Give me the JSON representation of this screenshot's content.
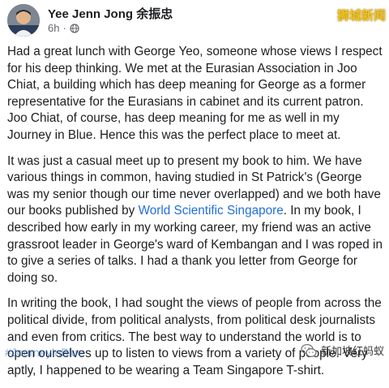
{
  "post": {
    "author_name": "Yee Jenn Jong 余振忠",
    "timestamp": "6h",
    "separator": "·",
    "paragraph1": "Had a great lunch with George Yeo, someone whose views I respect for his deep thinking. We met at the Eurasian Association in Joo Chiat, a building which has deep meaning for George as a former representative for the Eurasians in cabinet and its current patron. Joo Chiat, of course, has deep meaning for me as well in my Journey in Blue. Hence this was the perfect place to meet at.",
    "paragraph2_before_link": "It was just a casual meet up to present my book to him. We have various things in common, having studied in St Patrick's (George was my senior though our time never overlapped) and we both have our books published by ",
    "paragraph2_link": "World Scientific Singapore",
    "paragraph2_after_link": ". In my book, I described how early in my working career, my friend was an active grassroot leader in George's ward of Kembangan and I was roped in to give a series of talks. I had a thank you letter from George for doing so.",
    "paragraph3": "In writing the book, I had sought the views of people from across the political divide, from political analysts, from political desk journalists and even from critics. The best way to understand the world is to open ourselves up to listen to views from a variety of people. Very aptly, I happened to be wearing a Team Singapore T-shirt.",
    "hashtags": [
      "#JourneyInBlue"
    ]
  },
  "watermarks": {
    "top_right": "狮城新闻",
    "bottom_right": "新加坡红蚂蚁"
  },
  "colors": {
    "link": "#216fdb",
    "text": "#1c1e21",
    "meta": "#65676b"
  },
  "icons": {
    "privacy": "globe-icon",
    "watermark": "wechat-icon"
  }
}
